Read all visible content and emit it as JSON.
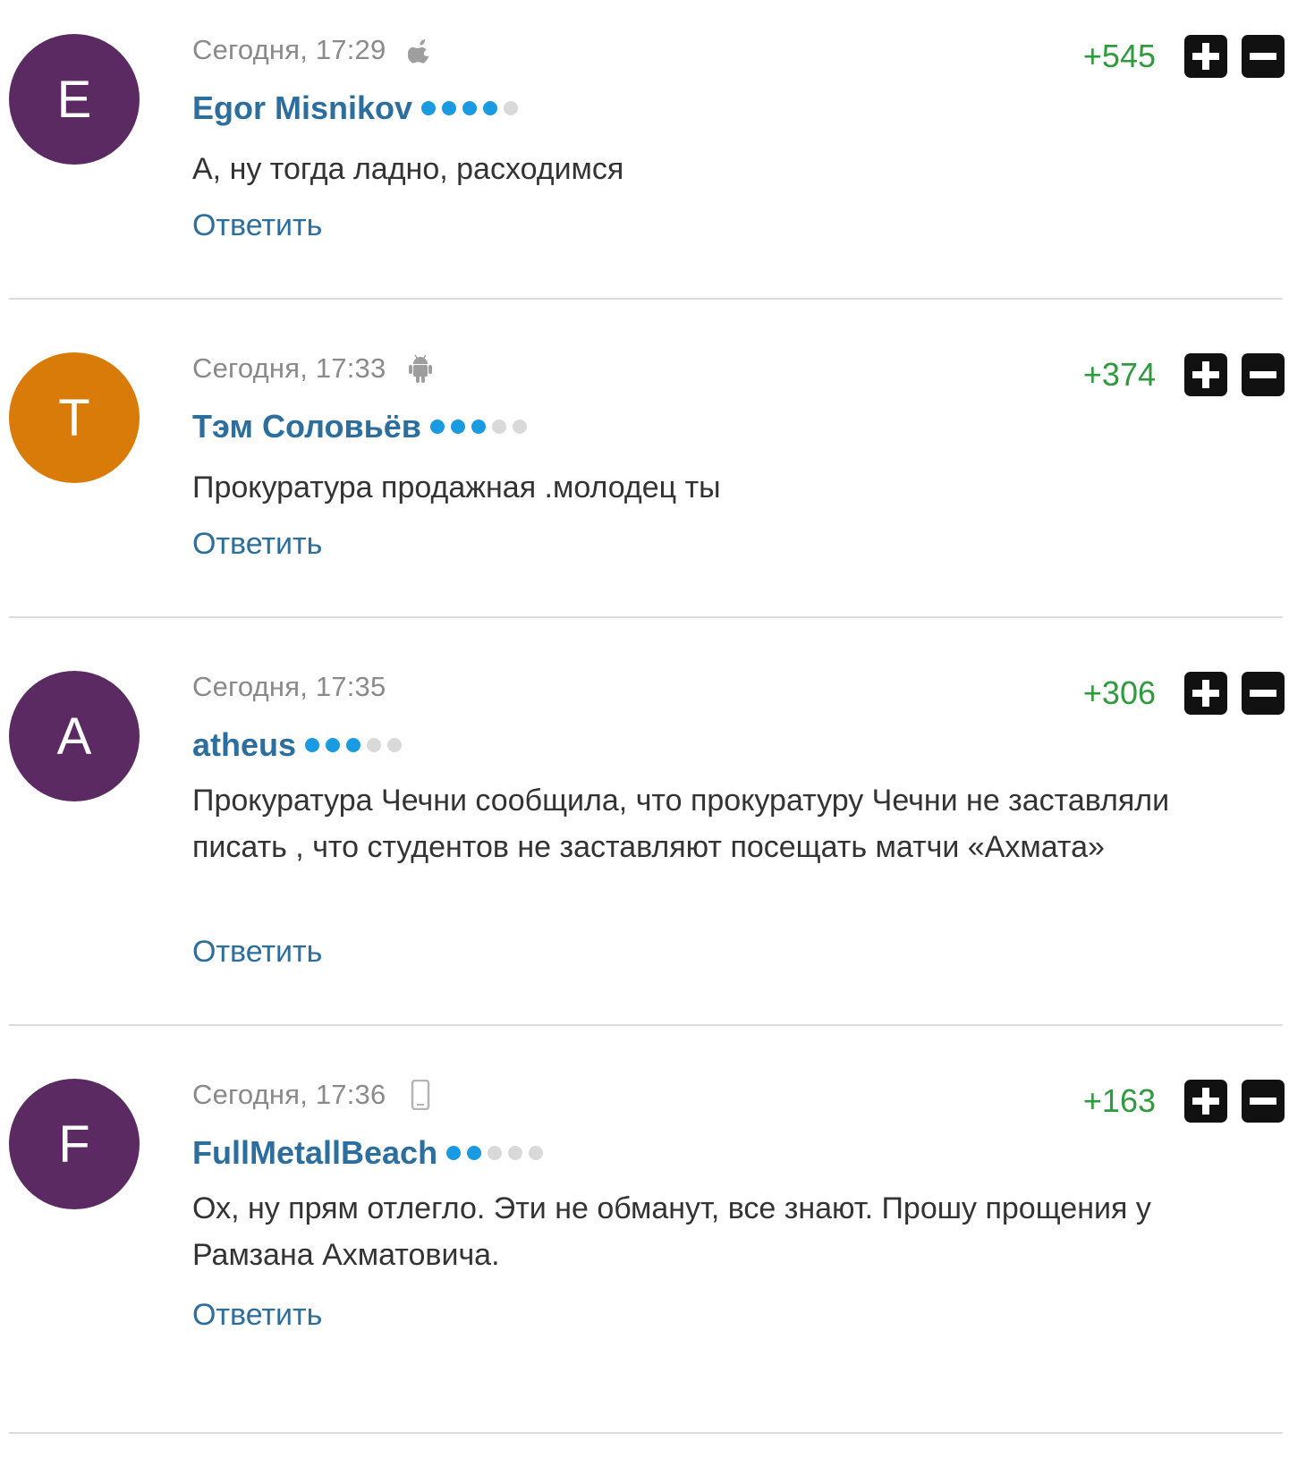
{
  "colors": {
    "avatar_purple": "#5b2a63",
    "avatar_orange": "#d97b08",
    "author_blue": "#2c6e9e",
    "score_green": "#2f9a3e",
    "dot_active": "#1a9ae0",
    "dot_inactive": "#d9d9d9",
    "vote_button_bg": "#111111"
  },
  "comments": [
    {
      "avatar_letter": "E",
      "avatar_color": "#5b2a63",
      "timestamp": "Сегодня, 17:29",
      "device_icon": "apple-icon",
      "author": "Egor Misnikov",
      "rank_active": 4,
      "rank_total": 5,
      "text": "А, ну тогда ладно, расходимся",
      "reply_label": "Ответить",
      "score": "+545"
    },
    {
      "avatar_letter": "Т",
      "avatar_color": "#d97b08",
      "timestamp": "Сегодня, 17:33",
      "device_icon": "android-icon",
      "author": "Тэм Соловьёв",
      "rank_active": 3,
      "rank_total": 5,
      "text": "Прокуратура продажная .молодец ты",
      "reply_label": "Ответить",
      "score": "+374"
    },
    {
      "avatar_letter": "A",
      "avatar_color": "#5b2a63",
      "timestamp": "Сегодня, 17:35",
      "device_icon": "",
      "author": "atheus",
      "rank_active": 3,
      "rank_total": 5,
      "text": "Прокуратура Чечни сообщила, что прокуратуру Чечни не заставляли писать , что студентов не заставляют посещать матчи «Ахмата»",
      "reply_label": "Ответить",
      "score": "+306"
    },
    {
      "avatar_letter": "F",
      "avatar_color": "#5b2a63",
      "timestamp": "Сегодня, 17:36",
      "device_icon": "mobile-phone-icon",
      "author": "FullMetallBeach",
      "rank_active": 2,
      "rank_total": 5,
      "text": "Ох, ну прям отлегло. Эти не обманут, все знают. Прошу прощения у Рамзана Ахматовича.",
      "reply_label": "Ответить",
      "score": "+163"
    }
  ]
}
